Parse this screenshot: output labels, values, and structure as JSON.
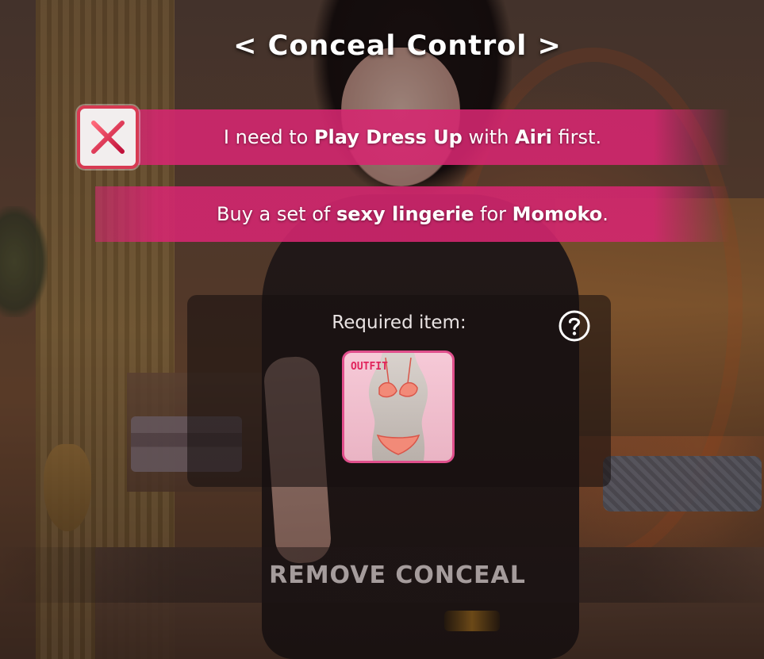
{
  "title": "< Conceal Control >",
  "requirements": [
    {
      "status": "not-met",
      "status_icon": "cross-icon",
      "parts": [
        "I need to ",
        "Play Dress Up",
        " with ",
        "Airi",
        " first."
      ]
    },
    {
      "parts": [
        "Buy a set of ",
        "sexy lingerie",
        " for ",
        "Momoko",
        "."
      ]
    }
  ],
  "required_item": {
    "label": "Required item:",
    "help_icon": "question-mark-icon",
    "item_tag": "OUTFIT",
    "item_icon": "lingerie-outfit-icon"
  },
  "remove_button_label": "REMOVE CONCEAL",
  "colors": {
    "banner": "#d62670",
    "cross_border": "#d73a52",
    "item_border": "#e04f8c",
    "button_text": "#a59c9c"
  }
}
